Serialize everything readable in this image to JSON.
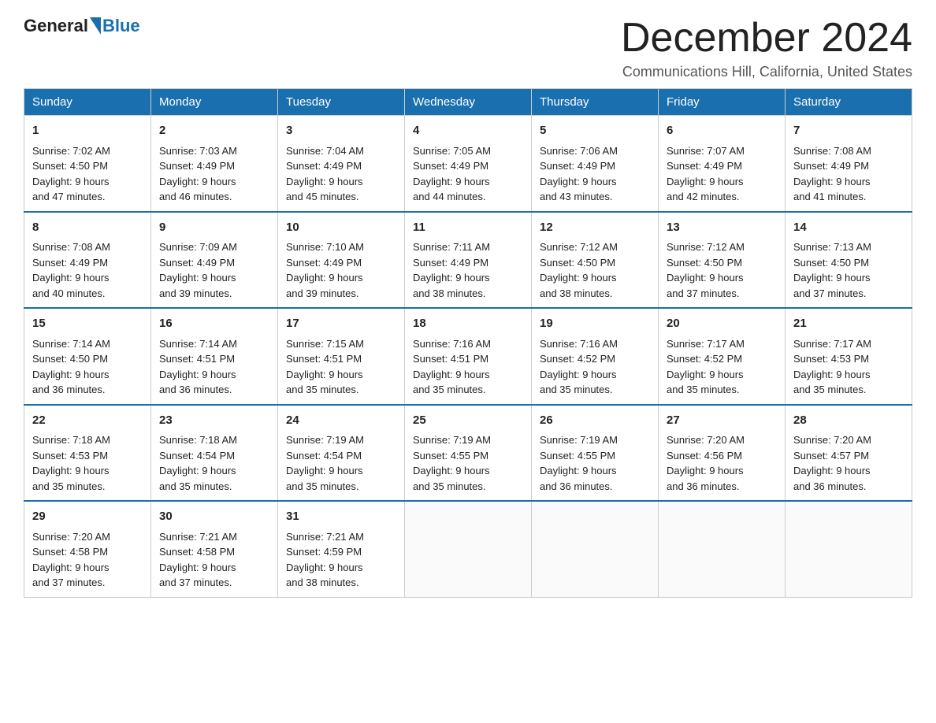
{
  "header": {
    "logo_general": "General",
    "logo_blue": "Blue",
    "month_title": "December 2024",
    "location": "Communications Hill, California, United States"
  },
  "days_of_week": [
    "Sunday",
    "Monday",
    "Tuesday",
    "Wednesday",
    "Thursday",
    "Friday",
    "Saturday"
  ],
  "weeks": [
    [
      {
        "day": "1",
        "sunrise": "7:02 AM",
        "sunset": "4:50 PM",
        "daylight": "9 hours and 47 minutes."
      },
      {
        "day": "2",
        "sunrise": "7:03 AM",
        "sunset": "4:49 PM",
        "daylight": "9 hours and 46 minutes."
      },
      {
        "day": "3",
        "sunrise": "7:04 AM",
        "sunset": "4:49 PM",
        "daylight": "9 hours and 45 minutes."
      },
      {
        "day": "4",
        "sunrise": "7:05 AM",
        "sunset": "4:49 PM",
        "daylight": "9 hours and 44 minutes."
      },
      {
        "day": "5",
        "sunrise": "7:06 AM",
        "sunset": "4:49 PM",
        "daylight": "9 hours and 43 minutes."
      },
      {
        "day": "6",
        "sunrise": "7:07 AM",
        "sunset": "4:49 PM",
        "daylight": "9 hours and 42 minutes."
      },
      {
        "day": "7",
        "sunrise": "7:08 AM",
        "sunset": "4:49 PM",
        "daylight": "9 hours and 41 minutes."
      }
    ],
    [
      {
        "day": "8",
        "sunrise": "7:08 AM",
        "sunset": "4:49 PM",
        "daylight": "9 hours and 40 minutes."
      },
      {
        "day": "9",
        "sunrise": "7:09 AM",
        "sunset": "4:49 PM",
        "daylight": "9 hours and 39 minutes."
      },
      {
        "day": "10",
        "sunrise": "7:10 AM",
        "sunset": "4:49 PM",
        "daylight": "9 hours and 39 minutes."
      },
      {
        "day": "11",
        "sunrise": "7:11 AM",
        "sunset": "4:49 PM",
        "daylight": "9 hours and 38 minutes."
      },
      {
        "day": "12",
        "sunrise": "7:12 AM",
        "sunset": "4:50 PM",
        "daylight": "9 hours and 38 minutes."
      },
      {
        "day": "13",
        "sunrise": "7:12 AM",
        "sunset": "4:50 PM",
        "daylight": "9 hours and 37 minutes."
      },
      {
        "day": "14",
        "sunrise": "7:13 AM",
        "sunset": "4:50 PM",
        "daylight": "9 hours and 37 minutes."
      }
    ],
    [
      {
        "day": "15",
        "sunrise": "7:14 AM",
        "sunset": "4:50 PM",
        "daylight": "9 hours and 36 minutes."
      },
      {
        "day": "16",
        "sunrise": "7:14 AM",
        "sunset": "4:51 PM",
        "daylight": "9 hours and 36 minutes."
      },
      {
        "day": "17",
        "sunrise": "7:15 AM",
        "sunset": "4:51 PM",
        "daylight": "9 hours and 35 minutes."
      },
      {
        "day": "18",
        "sunrise": "7:16 AM",
        "sunset": "4:51 PM",
        "daylight": "9 hours and 35 minutes."
      },
      {
        "day": "19",
        "sunrise": "7:16 AM",
        "sunset": "4:52 PM",
        "daylight": "9 hours and 35 minutes."
      },
      {
        "day": "20",
        "sunrise": "7:17 AM",
        "sunset": "4:52 PM",
        "daylight": "9 hours and 35 minutes."
      },
      {
        "day": "21",
        "sunrise": "7:17 AM",
        "sunset": "4:53 PM",
        "daylight": "9 hours and 35 minutes."
      }
    ],
    [
      {
        "day": "22",
        "sunrise": "7:18 AM",
        "sunset": "4:53 PM",
        "daylight": "9 hours and 35 minutes."
      },
      {
        "day": "23",
        "sunrise": "7:18 AM",
        "sunset": "4:54 PM",
        "daylight": "9 hours and 35 minutes."
      },
      {
        "day": "24",
        "sunrise": "7:19 AM",
        "sunset": "4:54 PM",
        "daylight": "9 hours and 35 minutes."
      },
      {
        "day": "25",
        "sunrise": "7:19 AM",
        "sunset": "4:55 PM",
        "daylight": "9 hours and 35 minutes."
      },
      {
        "day": "26",
        "sunrise": "7:19 AM",
        "sunset": "4:55 PM",
        "daylight": "9 hours and 36 minutes."
      },
      {
        "day": "27",
        "sunrise": "7:20 AM",
        "sunset": "4:56 PM",
        "daylight": "9 hours and 36 minutes."
      },
      {
        "day": "28",
        "sunrise": "7:20 AM",
        "sunset": "4:57 PM",
        "daylight": "9 hours and 36 minutes."
      }
    ],
    [
      {
        "day": "29",
        "sunrise": "7:20 AM",
        "sunset": "4:58 PM",
        "daylight": "9 hours and 37 minutes."
      },
      {
        "day": "30",
        "sunrise": "7:21 AM",
        "sunset": "4:58 PM",
        "daylight": "9 hours and 37 minutes."
      },
      {
        "day": "31",
        "sunrise": "7:21 AM",
        "sunset": "4:59 PM",
        "daylight": "9 hours and 38 minutes."
      },
      null,
      null,
      null,
      null
    ]
  ],
  "labels": {
    "sunrise": "Sunrise:",
    "sunset": "Sunset:",
    "daylight": "Daylight:"
  },
  "colors": {
    "header_bg": "#1a6faf",
    "header_text": "#ffffff",
    "border": "#cccccc",
    "top_border": "#1a6faf"
  }
}
